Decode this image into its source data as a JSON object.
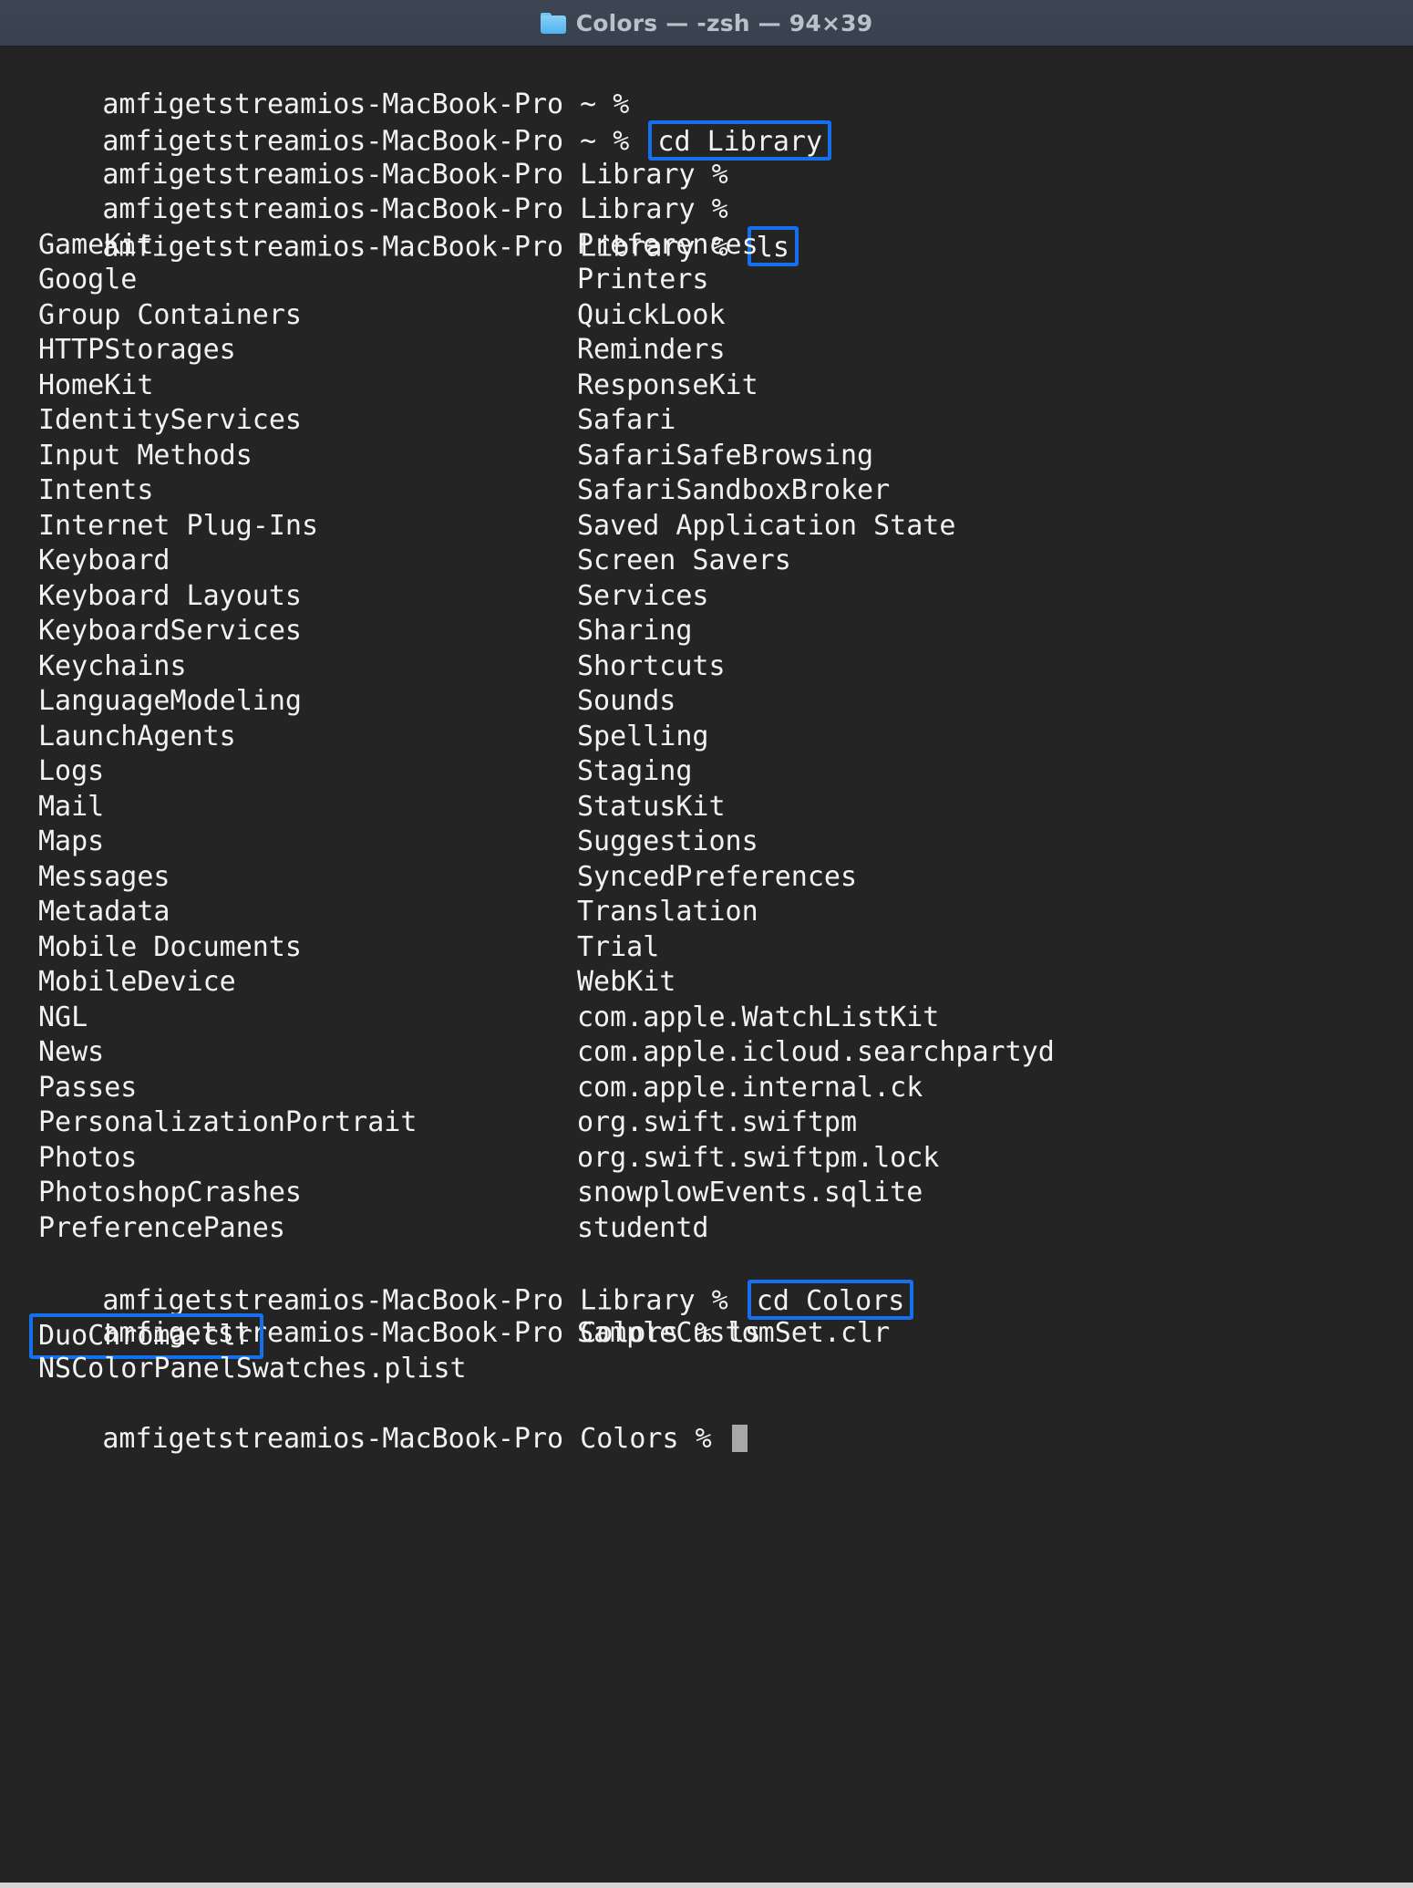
{
  "window": {
    "title": "Colors — -zsh — 94×39",
    "folder_icon": "folder-icon"
  },
  "colors": {
    "highlight": "#1570ef",
    "terminal_bg": "#242424",
    "titlebar_bg": "#39414e",
    "text": "#f2f2f2",
    "title_text": "#b9c1cc",
    "cursor": "#a8a8a8"
  },
  "prompts": {
    "home": "amfigetstreamios-MacBook-Pro ~ % ",
    "library": "amfigetstreamios-MacBook-Pro Library % ",
    "colors": "amfigetstreamios-MacBook-Pro Colors % "
  },
  "commands": {
    "cd_library": "cd Library",
    "ls": "ls",
    "cd_colors": "cd Colors",
    "ls_plain": "ls"
  },
  "library_listing": {
    "col1": [
      "GameKit",
      "Google",
      "Group Containers",
      "HTTPStorages",
      "HomeKit",
      "IdentityServices",
      "Input Methods",
      "Intents",
      "Internet Plug-Ins",
      "Keyboard",
      "Keyboard Layouts",
      "KeyboardServices",
      "Keychains",
      "LanguageModeling",
      "LaunchAgents",
      "Logs",
      "Mail",
      "Maps",
      "Messages",
      "Metadata",
      "Mobile Documents",
      "MobileDevice",
      "NGL",
      "News",
      "Passes",
      "PersonalizationPortrait",
      "Photos",
      "PhotoshopCrashes",
      "PreferencePanes"
    ],
    "col2": [
      "Preferences",
      "Printers",
      "QuickLook",
      "Reminders",
      "ResponseKit",
      "Safari",
      "SafariSafeBrowsing",
      "SafariSandboxBroker",
      "Saved Application State",
      "Screen Savers",
      "Services",
      "Sharing",
      "Shortcuts",
      "Sounds",
      "Spelling",
      "Staging",
      "StatusKit",
      "Suggestions",
      "SyncedPreferences",
      "Translation",
      "Trial",
      "WebKit",
      "com.apple.WatchListKit",
      "com.apple.icloud.searchpartyd",
      "com.apple.internal.ck",
      "org.swift.swiftpm",
      "org.swift.swiftpm.lock",
      "snowplowEvents.sqlite",
      "studentd"
    ]
  },
  "colors_listing": {
    "col1": [
      "DuoChroma.clr",
      "NSColorPanelSwatches.plist"
    ],
    "col2": [
      "SampleCustomSet.clr",
      ""
    ]
  }
}
